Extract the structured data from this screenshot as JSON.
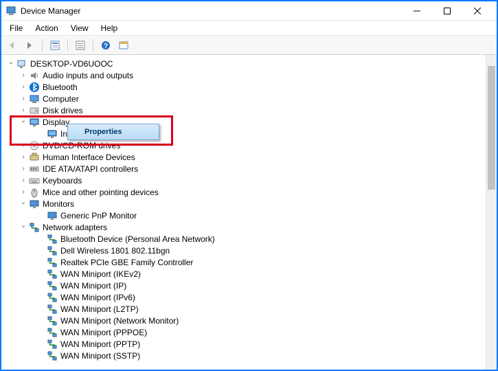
{
  "window": {
    "title": "Device Manager"
  },
  "menubar": [
    "File",
    "Action",
    "View",
    "Help"
  ],
  "context_menu": {
    "items": [
      "Properties"
    ]
  },
  "tree": {
    "root": "DESKTOP-VD6UOOC",
    "nodes": [
      {
        "label": "Audio inputs and outputs",
        "icon": "speaker",
        "exp": ">"
      },
      {
        "label": "Bluetooth",
        "icon": "bluetooth",
        "exp": ">"
      },
      {
        "label": "Computer",
        "icon": "computer",
        "exp": ">"
      },
      {
        "label": "Disk drives",
        "icon": "disk",
        "exp": ">"
      },
      {
        "label": "Display",
        "icon": "display",
        "exp": "v",
        "children": [
          {
            "label": "Intel",
            "icon": "display"
          }
        ]
      },
      {
        "label": "DVD/CD-ROM drives",
        "icon": "disc",
        "exp": ">"
      },
      {
        "label": "Human Interface Devices",
        "icon": "hid",
        "exp": ">"
      },
      {
        "label": "IDE ATA/ATAPI controllers",
        "icon": "ide",
        "exp": ">"
      },
      {
        "label": "Keyboards",
        "icon": "keyboard",
        "exp": ">"
      },
      {
        "label": "Mice and other pointing devices",
        "icon": "mouse",
        "exp": ">"
      },
      {
        "label": "Monitors",
        "icon": "monitor",
        "exp": "v",
        "children": [
          {
            "label": "Generic PnP Monitor",
            "icon": "monitor"
          }
        ]
      },
      {
        "label": "Network adapters",
        "icon": "network",
        "exp": "v",
        "children": [
          {
            "label": "Bluetooth Device (Personal Area Network)",
            "icon": "network"
          },
          {
            "label": "Dell Wireless 1801 802.11bgn",
            "icon": "network"
          },
          {
            "label": "Realtek PCIe GBE Family Controller",
            "icon": "network"
          },
          {
            "label": "WAN Miniport (IKEv2)",
            "icon": "network"
          },
          {
            "label": "WAN Miniport (IP)",
            "icon": "network"
          },
          {
            "label": "WAN Miniport (IPv6)",
            "icon": "network"
          },
          {
            "label": "WAN Miniport (L2TP)",
            "icon": "network"
          },
          {
            "label": "WAN Miniport (Network Monitor)",
            "icon": "network"
          },
          {
            "label": "WAN Miniport (PPPOE)",
            "icon": "network"
          },
          {
            "label": "WAN Miniport (PPTP)",
            "icon": "network"
          },
          {
            "label": "WAN Miniport (SSTP)",
            "icon": "network"
          }
        ]
      }
    ]
  }
}
